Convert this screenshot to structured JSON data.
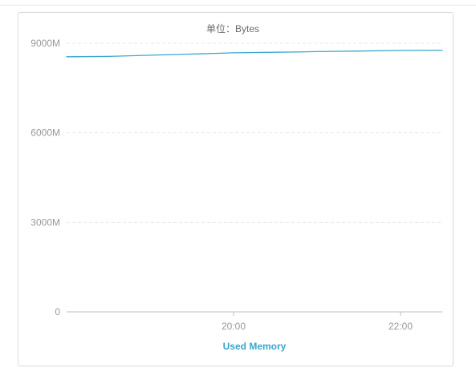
{
  "chart_data": {
    "type": "line",
    "unit_label": "单位：Bytes",
    "y_ticks": [
      {
        "value": 0,
        "label": "0"
      },
      {
        "value": 3000,
        "label": "3000M"
      },
      {
        "value": 6000,
        "label": "6000M"
      },
      {
        "value": 9000,
        "label": "9000M"
      }
    ],
    "ylim": [
      0,
      9000
    ],
    "x_ticks": [
      {
        "value": 20,
        "label": "20:00"
      },
      {
        "value": 22,
        "label": "22:00"
      }
    ],
    "xlim": [
      18.0,
      22.5
    ],
    "grid": true,
    "legend_position": "bottom",
    "series": [
      {
        "name": "Used Memory",
        "color": "#3aa6cf",
        "x": [
          18.0,
          18.5,
          19.0,
          19.5,
          20.0,
          20.5,
          21.0,
          21.5,
          22.0,
          22.5
        ],
        "values": [
          8550,
          8560,
          8600,
          8640,
          8680,
          8700,
          8720,
          8740,
          8760,
          8770
        ]
      }
    ]
  }
}
